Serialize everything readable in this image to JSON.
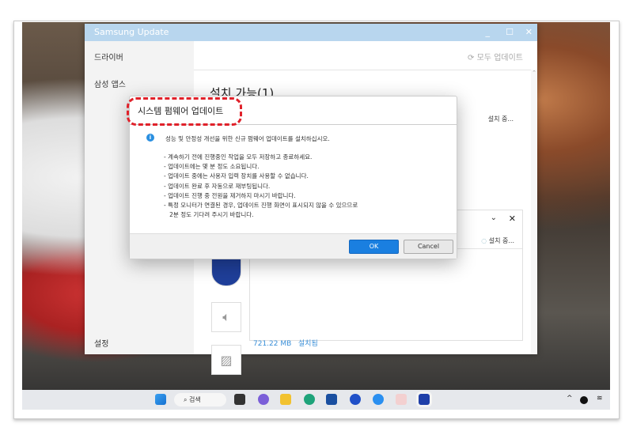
{
  "window": {
    "title": "Samsung Update",
    "minimize": "_",
    "maximize": "☐",
    "close": "✕"
  },
  "sidebar": {
    "items": [
      {
        "label": "드라이버"
      },
      {
        "label": "삼성 앱스"
      }
    ],
    "settings": "설정"
  },
  "main": {
    "update_all": "모두 업데이트",
    "section_title": "설치 가능(1)",
    "status_installing": "설치 중...",
    "card_status": "설치 중...",
    "size": "721.22 MB",
    "installed": "설치됨",
    "collapse": "⌄",
    "dismiss": "✕"
  },
  "dialog": {
    "title": "시스템 펌웨어 업데이트",
    "lead": "성능 및 안정성 개선을 위한 신규 펌웨어 업데이트를 설치하십시오.",
    "lines": [
      "- 계속하기 전에 진행중인 작업을 모두 저장하고 종료하세요.",
      "- 업데이트에는 몇 분 정도 소요됩니다.",
      "- 업데이트 중에는 사용자 입력 장치를 사용할 수 없습니다.",
      "- 업데이트 완료 후 자동으로 재부팅됩니다.",
      "- 업데이트 진행 중 전원을 제거하지 마시기 바랍니다.",
      "- 특정 모니터가 연결된 경우, 업데이트 진행 화면이 표시되지 않을 수 있으므로",
      "   2분 정도 기다려 주시기 바랍니다."
    ],
    "ok": "OK",
    "cancel": "Cancel"
  },
  "taskbar": {
    "search": "검색",
    "tray_chevron": "^"
  },
  "colors": {
    "accent": "#1a7fe0",
    "titlebar": "#b8d6ee",
    "highlight": "#e0212a"
  }
}
